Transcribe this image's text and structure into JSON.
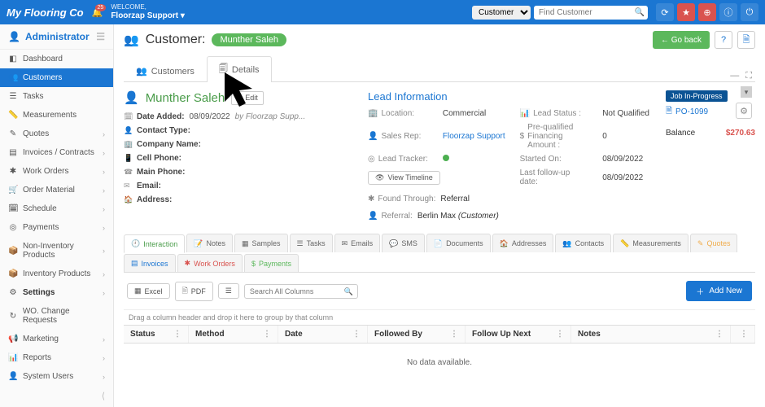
{
  "topbar": {
    "brand": "My Flooring Co",
    "bell_badge": "25",
    "welcome_label": "WELCOME,",
    "welcome_name": "Floorzap Support",
    "search_type": "Customer",
    "search_placeholder": "Find Customer"
  },
  "sidebar": {
    "header": "Administrator",
    "items": [
      {
        "icon": "◧",
        "label": "Dashboard",
        "expandable": false
      },
      {
        "icon": "👥",
        "label": "Customers",
        "expandable": false,
        "active": true
      },
      {
        "icon": "☰",
        "label": "Tasks",
        "expandable": false
      },
      {
        "icon": "📏",
        "label": "Measurements",
        "expandable": false
      },
      {
        "icon": "✎",
        "label": "Quotes",
        "expandable": true
      },
      {
        "icon": "▤",
        "label": "Invoices / Contracts",
        "expandable": true
      },
      {
        "icon": "✱",
        "label": "Work Orders",
        "expandable": true
      },
      {
        "icon": "🛒",
        "label": "Order Material",
        "expandable": true
      },
      {
        "icon": "🗓",
        "label": "Schedule",
        "expandable": true
      },
      {
        "icon": "◎",
        "label": "Payments",
        "expandable": true
      },
      {
        "icon": "📦",
        "label": "Non-Inventory Products",
        "expandable": true
      },
      {
        "icon": "📦",
        "label": "Inventory Products",
        "expandable": true
      },
      {
        "icon": "⚙",
        "label": "Settings",
        "expandable": true,
        "bold": true
      },
      {
        "icon": "↻",
        "label": "WO. Change Requests",
        "expandable": false
      },
      {
        "icon": "📢",
        "label": "Marketing",
        "expandable": true
      },
      {
        "icon": "📊",
        "label": "Reports",
        "expandable": true
      },
      {
        "icon": "👤",
        "label": "System Users",
        "expandable": true
      }
    ]
  },
  "page": {
    "title": "Customer:",
    "customer_badge": "Munther Saleh",
    "goback": "Go back"
  },
  "tabs": {
    "customers": "Customers",
    "details": "Details"
  },
  "customer": {
    "name": "Munther Saleh",
    "edit": "Edit",
    "fields": [
      {
        "icon": "🗓",
        "label": "Date Added:",
        "value": "08/09/2022",
        "by": "by Floorzap Supp..."
      },
      {
        "icon": "👤",
        "label": "Contact Type:",
        "value": ""
      },
      {
        "icon": "🏢",
        "label": "Company Name:",
        "value": ""
      },
      {
        "icon": "📱",
        "label": "Cell Phone:",
        "value": ""
      },
      {
        "icon": "☎",
        "label": "Main Phone:",
        "value": ""
      },
      {
        "icon": "✉",
        "label": "Email:",
        "value": ""
      },
      {
        "icon": "🏠",
        "label": "Address:",
        "value": ""
      }
    ]
  },
  "lead": {
    "title": "Lead Information",
    "location": {
      "label": "Location:",
      "value": "Commercial"
    },
    "status": {
      "label": "Lead Status :",
      "value": "Not Qualified"
    },
    "rep": {
      "label": "Sales Rep:",
      "value": "Floorzap Support"
    },
    "financing": {
      "label": "Pre-qualified Financing Amount :",
      "value": "0"
    },
    "tracker": {
      "label": "Lead Tracker:"
    },
    "started": {
      "label": "Started On:",
      "value": "08/09/2022"
    },
    "followup": {
      "label": "Last follow-up date:",
      "value": "08/09/2022"
    },
    "view_timeline": "View Timeline",
    "found": {
      "label": "Found Through:",
      "value": "Referral"
    },
    "referral": {
      "label": "Referral:",
      "value_name": "Berlin Max",
      "value_role": "(Customer)"
    }
  },
  "job": {
    "status": "Job In-Progress",
    "po": "PO-1099",
    "balance_label": "Balance",
    "balance_value": "$270.63"
  },
  "subtabs": [
    {
      "icon": "🕘",
      "label": "Interaction",
      "active": true
    },
    {
      "icon": "📝",
      "label": "Notes"
    },
    {
      "icon": "▦",
      "label": "Samples"
    },
    {
      "icon": "☰",
      "label": "Tasks"
    },
    {
      "icon": "✉",
      "label": "Emails"
    },
    {
      "icon": "💬",
      "label": "SMS"
    },
    {
      "icon": "📄",
      "label": "Documents"
    },
    {
      "icon": "🏠",
      "label": "Addresses"
    },
    {
      "icon": "👥",
      "label": "Contacts"
    },
    {
      "icon": "📏",
      "label": "Measurements"
    },
    {
      "icon": "✎",
      "label": "Quotes",
      "cls": "quotes"
    },
    {
      "icon": "▤",
      "label": "Invoices",
      "cls": "invoices"
    },
    {
      "icon": "✱",
      "label": "Work Orders",
      "cls": "wo"
    },
    {
      "icon": "$",
      "label": "Payments",
      "cls": "pay"
    }
  ],
  "grid": {
    "excel": "Excel",
    "pdf": "PDF",
    "search_placeholder": "Search All Columns",
    "addnew": "Add New",
    "group_hint": "Drag a column header and drop it here to group by that column",
    "columns": [
      "Status",
      "Method",
      "Date",
      "Followed By",
      "Follow Up Next",
      "Notes"
    ],
    "no_data": "No data available."
  }
}
